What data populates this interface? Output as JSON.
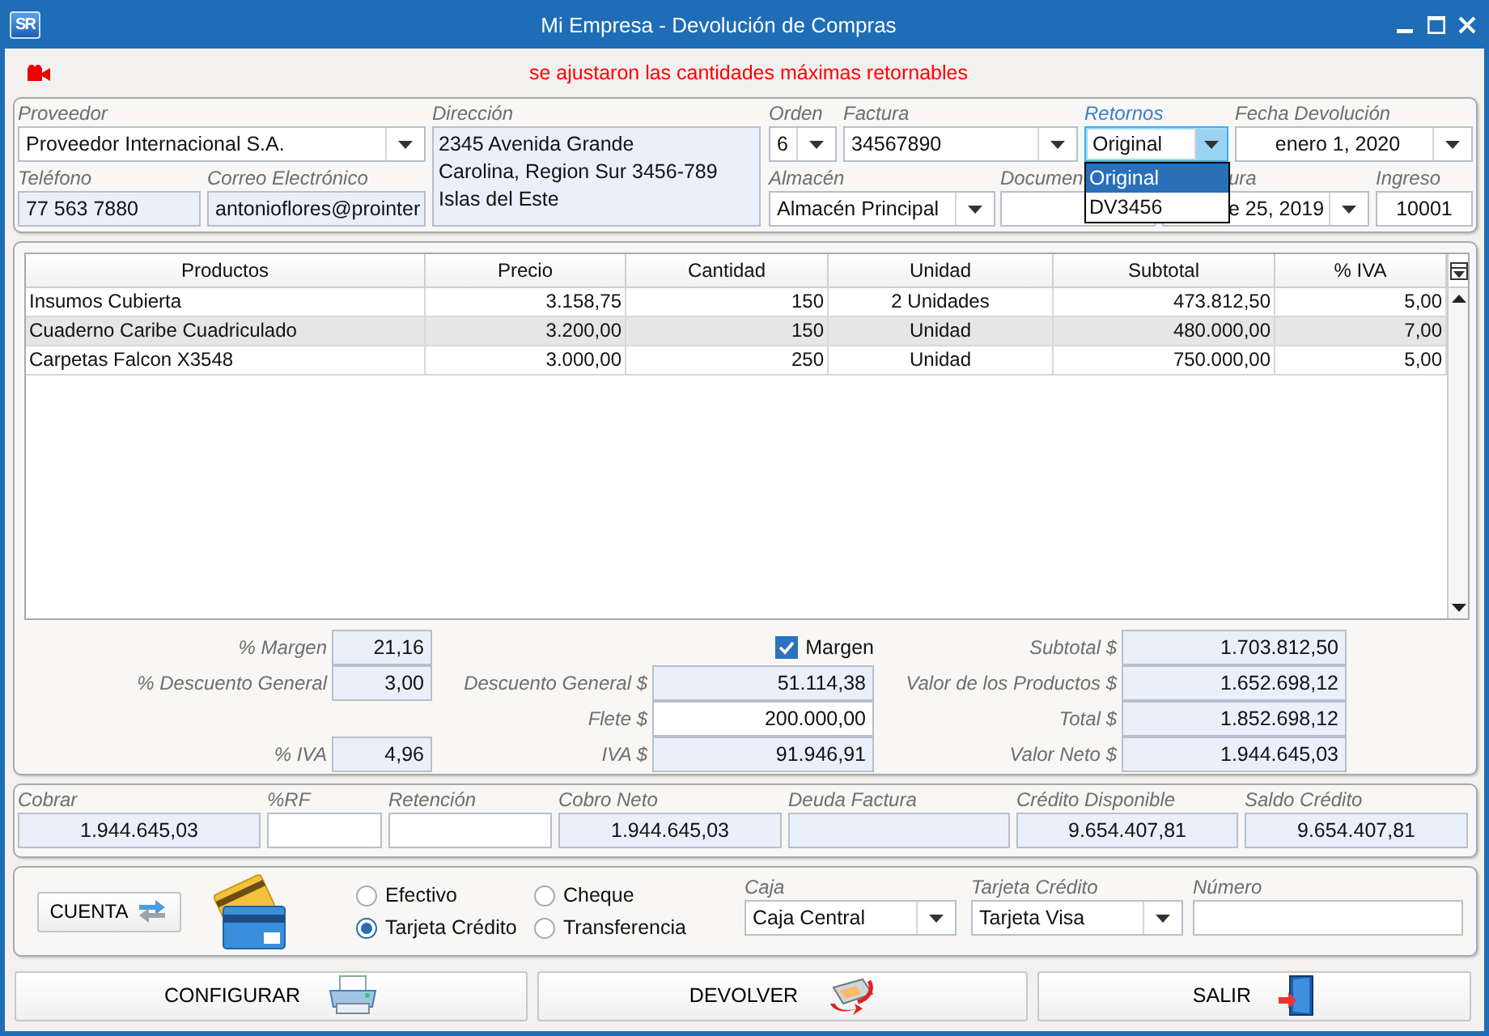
{
  "window": {
    "logo": "SR",
    "title": "Mi Empresa - Devolución de Compras"
  },
  "alert": "se ajustaron las cantidades máximas retornables",
  "header": {
    "supplier": {
      "label": "Proveedor",
      "value": "Proveedor Internacional S.A."
    },
    "phone": {
      "label": "Teléfono",
      "value": "77 563 7880"
    },
    "email": {
      "label": "Correo Electrónico",
      "value": "antonioflores@prointer"
    },
    "address": {
      "label": "Dirección",
      "lines": [
        "2345 Avenida Grande",
        "Carolina, Region Sur 3456-789",
        "Islas del Este"
      ]
    },
    "order": {
      "label": "Orden",
      "value": "6"
    },
    "invoice": {
      "label": "Factura",
      "value": "34567890"
    },
    "returns": {
      "label": "Retornos",
      "value": "Original",
      "expanded": true,
      "options": [
        {
          "label": "Original",
          "selected": true
        },
        {
          "label": "DV3456",
          "selected": false
        }
      ]
    },
    "return_date": {
      "label": "Fecha Devolución",
      "value": "enero 1, 2020"
    },
    "warehouse": {
      "label": "Almacén",
      "value": "Almacén Principal"
    },
    "document": {
      "label": "Documen"
    },
    "invoice_date": {
      "label": "ura",
      "value": "e 25, 2019"
    },
    "entry": {
      "label": "Ingreso",
      "value": "10001"
    }
  },
  "table": {
    "columns": [
      {
        "label": "Productos"
      },
      {
        "label": "Precio"
      },
      {
        "label": "Cantidad"
      },
      {
        "label": "Unidad"
      },
      {
        "label": "Subtotal"
      },
      {
        "label": "% IVA"
      }
    ],
    "rows": [
      {
        "selected": false,
        "cells": [
          "Insumos Cubierta",
          "3.158,75",
          "150",
          "2 Unidades",
          "473.812,50",
          "5,00"
        ]
      },
      {
        "selected": true,
        "cells": [
          "Cuaderno Caribe Cuadriculado",
          "3.200,00",
          "150",
          "Unidad",
          "480.000,00",
          "7,00"
        ]
      },
      {
        "selected": false,
        "cells": [
          "Carpetas Falcon X3548",
          "3.000,00",
          "250",
          "Unidad",
          "750.000,00",
          "5,00"
        ]
      }
    ]
  },
  "totals": {
    "rows": [
      {
        "left": {
          "label": "% Margen",
          "value": "21,16",
          "editable": false
        },
        "check": {
          "label": "Margen",
          "checked": true
        },
        "right": {
          "label": "Subtotal $",
          "value": "1.703.812,50",
          "editable": false
        }
      },
      {
        "left": {
          "label": "% Descuento General",
          "value": "3,00",
          "editable": false
        },
        "middle": {
          "label": "Descuento General $",
          "value": "51.114,38",
          "editable": false
        },
        "right": {
          "label": "Valor de los Productos $",
          "value": "1.652.698,12",
          "editable": false
        }
      },
      {
        "middle": {
          "label": "Flete $",
          "value": "200.000,00",
          "editable": true
        },
        "right": {
          "label": "Total $",
          "value": "1.852.698,12",
          "editable": false
        }
      },
      {
        "left": {
          "label": "% IVA",
          "value": "4,96",
          "editable": false
        },
        "middle": {
          "label": "IVA $",
          "value": "91.946,91",
          "editable": false
        },
        "right": {
          "label": "Valor Neto $",
          "value": "1.944.645,03",
          "editable": false
        }
      }
    ]
  },
  "payment": [
    {
      "label": "Cobrar",
      "value": "1.944.645,03",
      "editable": false
    },
    {
      "label": "%RF",
      "editable": true
    },
    {
      "label": "Retención",
      "editable": true
    },
    {
      "label": "Cobro Neto",
      "value": "1.944.645,03",
      "editable": false
    },
    {
      "label": "Deuda Factura",
      "editable": false
    },
    {
      "label": "Crédito Disponible",
      "value": "9.654.407,81",
      "editable": false
    },
    {
      "label": "Saldo Crédito",
      "value": "9.654.407,81",
      "editable": false
    }
  ],
  "options": {
    "account_button": "CUENTA",
    "methods": [
      {
        "label": "Efectivo",
        "selected": false
      },
      {
        "label": "Cheque",
        "selected": false
      },
      {
        "label": "Tarjeta Crédito",
        "selected": true
      },
      {
        "label": "Transferencia",
        "selected": false
      }
    ],
    "cash_box": {
      "label": "Caja",
      "value": "Caja Central"
    },
    "card": {
      "label": "Tarjeta Crédito",
      "value": "Tarjeta Visa"
    },
    "number": {
      "label": "Número"
    }
  },
  "buttons": [
    {
      "label": "CONFIGURAR",
      "kind": "print"
    },
    {
      "label": "DEVOLVER",
      "kind": "return"
    },
    {
      "label": "SALIR",
      "kind": "exit"
    }
  ]
}
